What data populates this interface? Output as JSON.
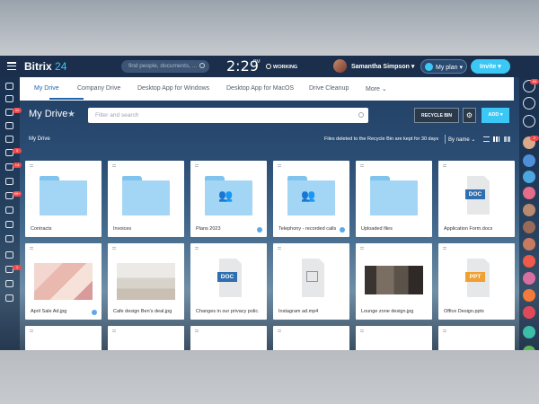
{
  "header": {
    "logo_main": "Bitrix",
    "logo_num": "24",
    "search_placeholder": "find people, documents, ...",
    "clock": "2:29",
    "clock_period": "PM",
    "working_label": "WORKING",
    "user_name": "Samantha Simpson",
    "plan_label": "My plan",
    "invite_label": "Invite"
  },
  "tabs": [
    "My Drive",
    "Company Drive",
    "Desktop App for Windows",
    "Desktop App for MacOS",
    "Drive Cleanup",
    "More"
  ],
  "toolbar": {
    "title": "My Drive",
    "filter_placeholder": "Filter and search",
    "recycle_label": "RECYCLE BIN",
    "add_label": "ADD"
  },
  "subbar": {
    "breadcrumb": "My Drive",
    "recycle_note": "Files deleted to the Recycle Bin are kept for 30 days",
    "sort_label": "By name"
  },
  "left_badges": [
    "11",
    "3",
    "14",
    "99+",
    "1"
  ],
  "right_badges": [
    "64",
    "2"
  ],
  "files": [
    {
      "name": "Contracts",
      "kind": "folder"
    },
    {
      "name": "Invoices",
      "kind": "folder"
    },
    {
      "name": "Plans 2023",
      "kind": "shared-folder",
      "shared": true
    },
    {
      "name": "Telephony - recorded calls",
      "kind": "shared-folder",
      "shared": true
    },
    {
      "name": "Uploaded files",
      "kind": "folder"
    },
    {
      "name": "Application Form.docx",
      "kind": "doc",
      "tag": "DOC"
    },
    {
      "name": "April Sale Ad.jpg",
      "kind": "image",
      "shared": true
    },
    {
      "name": "Cafe design Ben's deal.jpg",
      "kind": "image"
    },
    {
      "name": "Changes in our privacy polic...",
      "kind": "doc",
      "tag": "DOC"
    },
    {
      "name": "Instagram ad.mp4",
      "kind": "video"
    },
    {
      "name": "Lounge zone design.jpg",
      "kind": "image"
    },
    {
      "name": "Office Design.pptx",
      "kind": "doc",
      "tag": "PPT"
    }
  ],
  "colors": {
    "accent": "#3bc8f5",
    "header": "#1b2f4c",
    "doc_tag": "#2f6fb0",
    "ppt_tag": "#f0a030"
  }
}
